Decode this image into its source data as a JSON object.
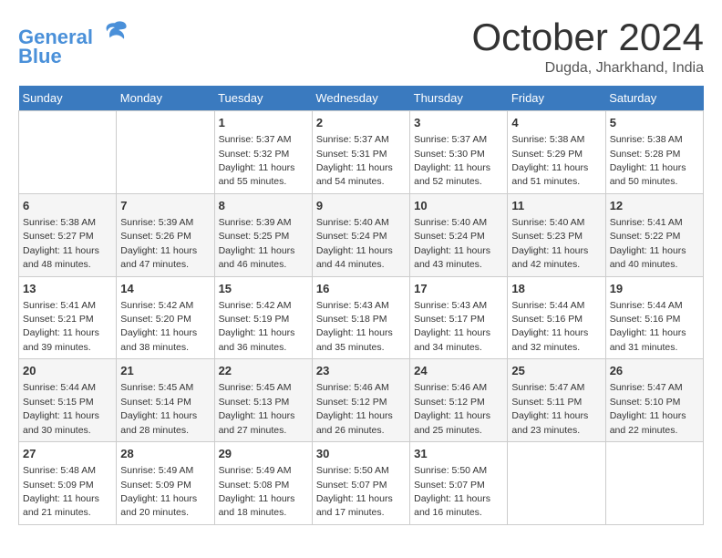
{
  "header": {
    "logo_line1": "General",
    "logo_line2": "Blue",
    "month": "October 2024",
    "location": "Dugda, Jharkhand, India"
  },
  "weekdays": [
    "Sunday",
    "Monday",
    "Tuesday",
    "Wednesday",
    "Thursday",
    "Friday",
    "Saturday"
  ],
  "weeks": [
    [
      null,
      null,
      {
        "day": 1,
        "sunrise": "5:37 AM",
        "sunset": "5:32 PM",
        "daylight": "11 hours and 55 minutes."
      },
      {
        "day": 2,
        "sunrise": "5:37 AM",
        "sunset": "5:31 PM",
        "daylight": "11 hours and 54 minutes."
      },
      {
        "day": 3,
        "sunrise": "5:37 AM",
        "sunset": "5:30 PM",
        "daylight": "11 hours and 52 minutes."
      },
      {
        "day": 4,
        "sunrise": "5:38 AM",
        "sunset": "5:29 PM",
        "daylight": "11 hours and 51 minutes."
      },
      {
        "day": 5,
        "sunrise": "5:38 AM",
        "sunset": "5:28 PM",
        "daylight": "11 hours and 50 minutes."
      }
    ],
    [
      {
        "day": 6,
        "sunrise": "5:38 AM",
        "sunset": "5:27 PM",
        "daylight": "11 hours and 48 minutes."
      },
      {
        "day": 7,
        "sunrise": "5:39 AM",
        "sunset": "5:26 PM",
        "daylight": "11 hours and 47 minutes."
      },
      {
        "day": 8,
        "sunrise": "5:39 AM",
        "sunset": "5:25 PM",
        "daylight": "11 hours and 46 minutes."
      },
      {
        "day": 9,
        "sunrise": "5:40 AM",
        "sunset": "5:24 PM",
        "daylight": "11 hours and 44 minutes."
      },
      {
        "day": 10,
        "sunrise": "5:40 AM",
        "sunset": "5:24 PM",
        "daylight": "11 hours and 43 minutes."
      },
      {
        "day": 11,
        "sunrise": "5:40 AM",
        "sunset": "5:23 PM",
        "daylight": "11 hours and 42 minutes."
      },
      {
        "day": 12,
        "sunrise": "5:41 AM",
        "sunset": "5:22 PM",
        "daylight": "11 hours and 40 minutes."
      }
    ],
    [
      {
        "day": 13,
        "sunrise": "5:41 AM",
        "sunset": "5:21 PM",
        "daylight": "11 hours and 39 minutes."
      },
      {
        "day": 14,
        "sunrise": "5:42 AM",
        "sunset": "5:20 PM",
        "daylight": "11 hours and 38 minutes."
      },
      {
        "day": 15,
        "sunrise": "5:42 AM",
        "sunset": "5:19 PM",
        "daylight": "11 hours and 36 minutes."
      },
      {
        "day": 16,
        "sunrise": "5:43 AM",
        "sunset": "5:18 PM",
        "daylight": "11 hours and 35 minutes."
      },
      {
        "day": 17,
        "sunrise": "5:43 AM",
        "sunset": "5:17 PM",
        "daylight": "11 hours and 34 minutes."
      },
      {
        "day": 18,
        "sunrise": "5:44 AM",
        "sunset": "5:16 PM",
        "daylight": "11 hours and 32 minutes."
      },
      {
        "day": 19,
        "sunrise": "5:44 AM",
        "sunset": "5:16 PM",
        "daylight": "11 hours and 31 minutes."
      }
    ],
    [
      {
        "day": 20,
        "sunrise": "5:44 AM",
        "sunset": "5:15 PM",
        "daylight": "11 hours and 30 minutes."
      },
      {
        "day": 21,
        "sunrise": "5:45 AM",
        "sunset": "5:14 PM",
        "daylight": "11 hours and 28 minutes."
      },
      {
        "day": 22,
        "sunrise": "5:45 AM",
        "sunset": "5:13 PM",
        "daylight": "11 hours and 27 minutes."
      },
      {
        "day": 23,
        "sunrise": "5:46 AM",
        "sunset": "5:12 PM",
        "daylight": "11 hours and 26 minutes."
      },
      {
        "day": 24,
        "sunrise": "5:46 AM",
        "sunset": "5:12 PM",
        "daylight": "11 hours and 25 minutes."
      },
      {
        "day": 25,
        "sunrise": "5:47 AM",
        "sunset": "5:11 PM",
        "daylight": "11 hours and 23 minutes."
      },
      {
        "day": 26,
        "sunrise": "5:47 AM",
        "sunset": "5:10 PM",
        "daylight": "11 hours and 22 minutes."
      }
    ],
    [
      {
        "day": 27,
        "sunrise": "5:48 AM",
        "sunset": "5:09 PM",
        "daylight": "11 hours and 21 minutes."
      },
      {
        "day": 28,
        "sunrise": "5:49 AM",
        "sunset": "5:09 PM",
        "daylight": "11 hours and 20 minutes."
      },
      {
        "day": 29,
        "sunrise": "5:49 AM",
        "sunset": "5:08 PM",
        "daylight": "11 hours and 18 minutes."
      },
      {
        "day": 30,
        "sunrise": "5:50 AM",
        "sunset": "5:07 PM",
        "daylight": "11 hours and 17 minutes."
      },
      {
        "day": 31,
        "sunrise": "5:50 AM",
        "sunset": "5:07 PM",
        "daylight": "11 hours and 16 minutes."
      },
      null,
      null
    ]
  ]
}
